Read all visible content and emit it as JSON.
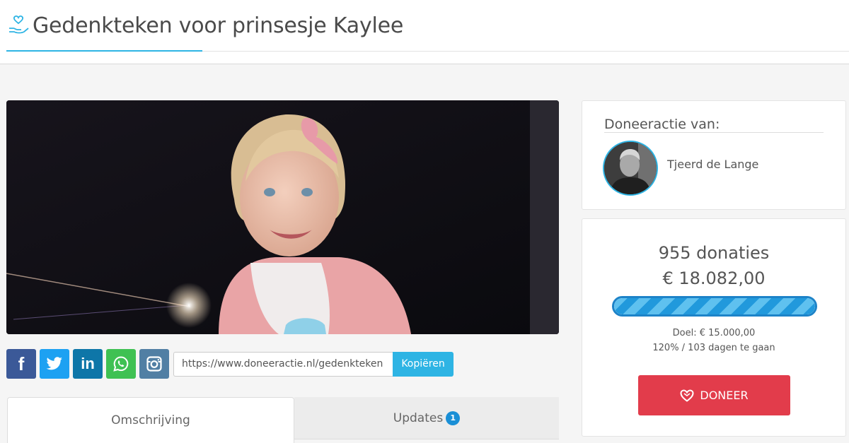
{
  "header": {
    "title": "Gedenkteken voor prinsesje Kaylee",
    "logo_icon": "hand-heart-icon"
  },
  "share": {
    "buttons": [
      {
        "name": "facebook",
        "icon": "facebook-icon",
        "glyph": "f",
        "color": "#3b5998"
      },
      {
        "name": "twitter",
        "icon": "twitter-icon",
        "color": "#1da1f2"
      },
      {
        "name": "linkedin",
        "icon": "linkedin-icon",
        "glyph": "in",
        "color": "#0e76a8"
      },
      {
        "name": "whatsapp",
        "icon": "whatsapp-icon",
        "color": "#3fc153"
      },
      {
        "name": "instagram",
        "icon": "instagram-icon",
        "color": "#517fa4"
      }
    ],
    "url_value": "https://www.doneeractie.nl/gedenkteken",
    "copy_label": "Kopiëren"
  },
  "tabs": [
    {
      "label": "Omschrijving",
      "active": true
    },
    {
      "label": "Updates",
      "badge": "1",
      "active": false
    }
  ],
  "organizer": {
    "label": "Doneeractie van:",
    "name": "Tjeerd de Lange"
  },
  "stats": {
    "donations": "955 donaties",
    "amount": "€ 18.082,00",
    "progress_fraction": 1.0,
    "goal": "Doel: € 15.000,00",
    "status": "120% / 103 dagen te gaan",
    "donate_label": "DONEER"
  },
  "colors": {
    "accent": "#2eb4e4",
    "donate": "#e23c4b",
    "progress": "#1d83c8"
  }
}
